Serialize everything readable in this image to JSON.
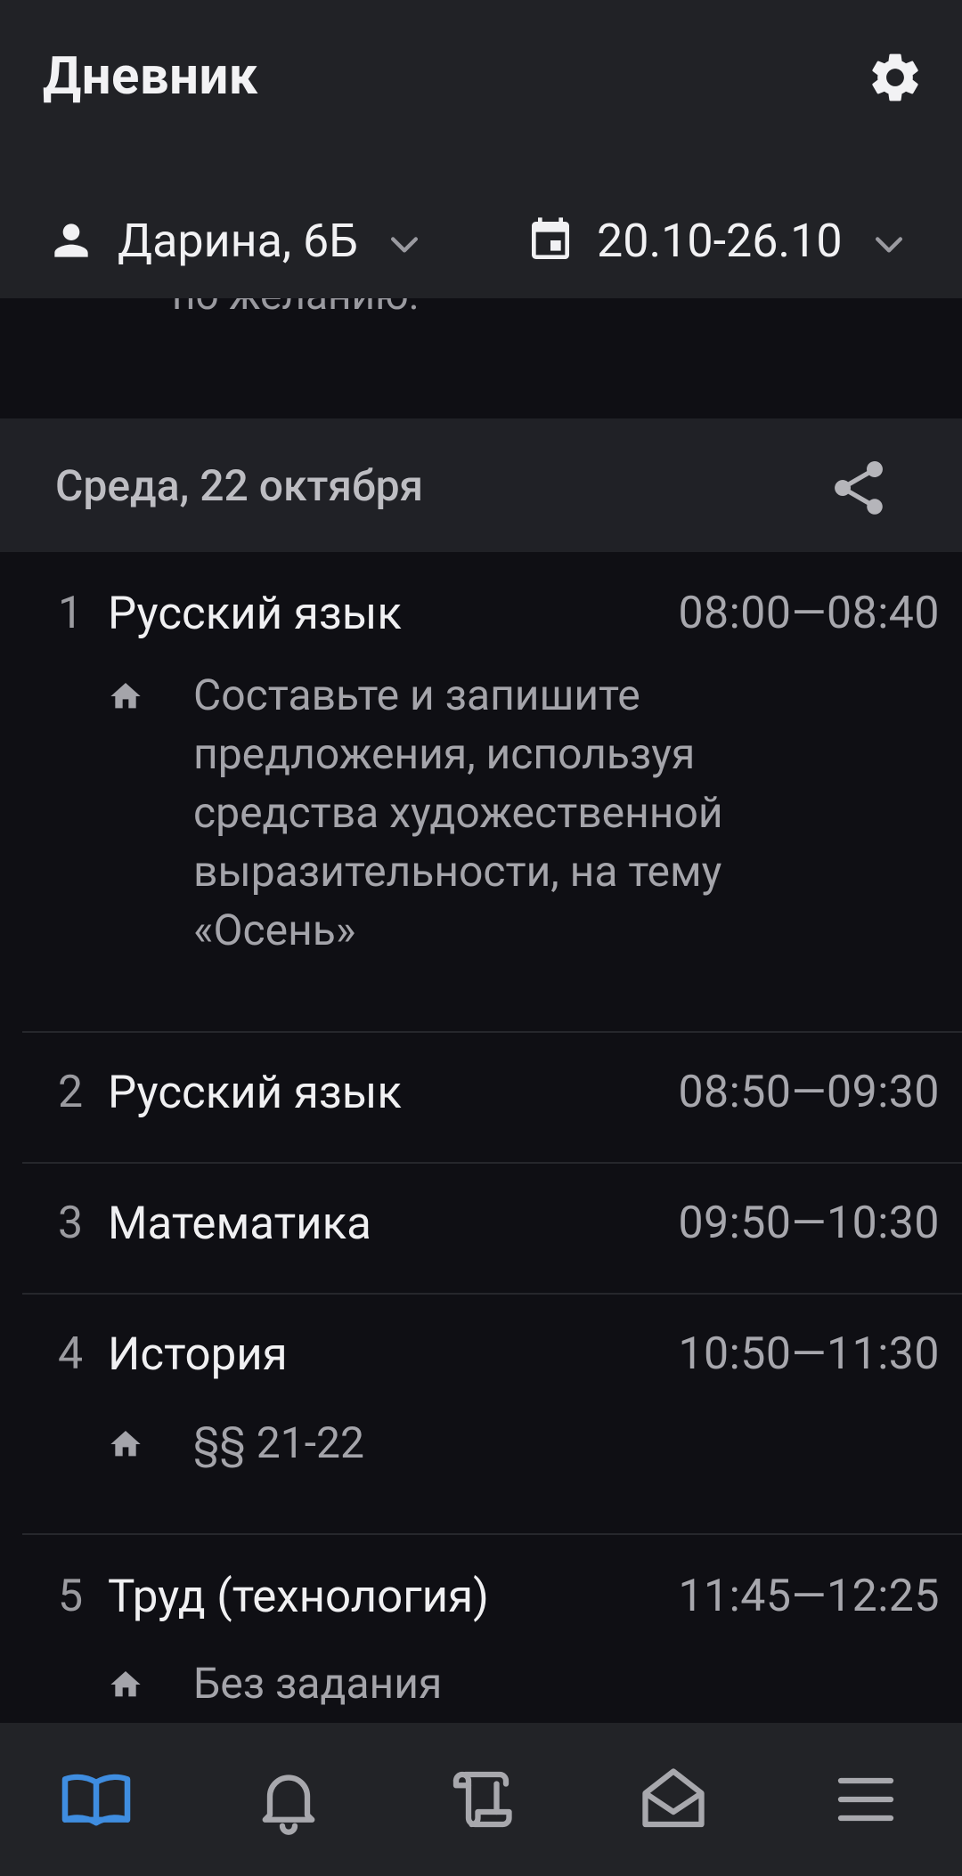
{
  "app": {
    "title": "Дневник"
  },
  "filters": {
    "student": "Дарина, 6Б",
    "week": "20.10-26.10"
  },
  "prev_item": {
    "text": "по желанию."
  },
  "day": {
    "title": "Среда, 22 октября"
  },
  "lessons": [
    {
      "num": "1",
      "subject": "Русский язык",
      "time": "08:00—08:40",
      "homework": "Составьте и запишите предложения, используя средства художественной выразительности, на тему «Осень»"
    },
    {
      "num": "2",
      "subject": "Русский язык",
      "time": "08:50—09:30",
      "homework": ""
    },
    {
      "num": "3",
      "subject": "Математика",
      "time": "09:50—10:30",
      "homework": ""
    },
    {
      "num": "4",
      "subject": "История",
      "time": "10:50—11:30",
      "homework": "§§ 21-22"
    },
    {
      "num": "5",
      "subject": "Труд (технология)",
      "time": "11:45—12:25",
      "homework": "Без задания"
    }
  ],
  "nav": {
    "items": [
      {
        "icon": "book-icon",
        "active": true
      },
      {
        "icon": "bell-icon",
        "active": false
      },
      {
        "icon": "scroll-icon",
        "active": false
      },
      {
        "icon": "envelope-open-icon",
        "active": false
      },
      {
        "icon": "menu-icon",
        "active": false
      }
    ]
  },
  "colors": {
    "accent": "#3f8de0",
    "background": "#0f0f14",
    "bar": "#212226"
  }
}
